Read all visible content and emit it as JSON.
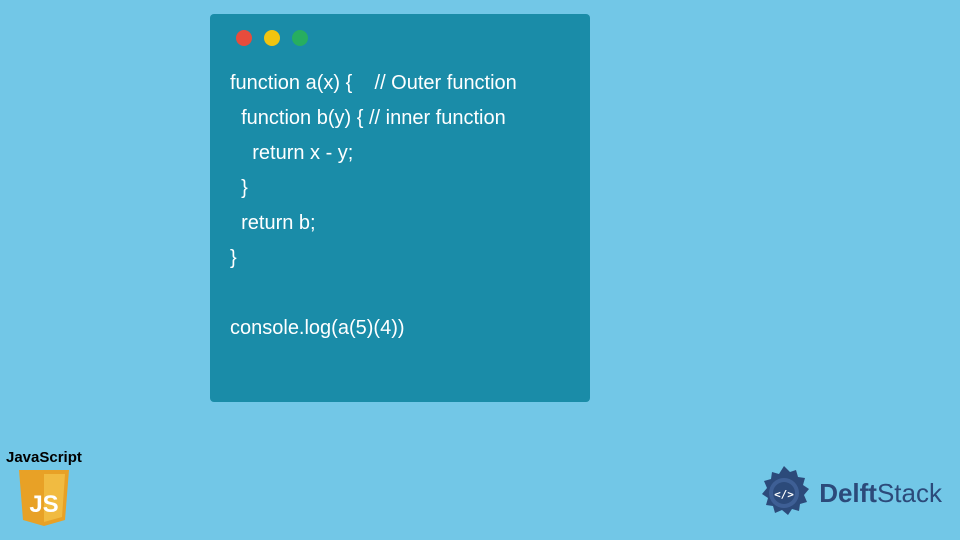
{
  "code": {
    "line1": "function a(x) {    // Outer function",
    "line2": "  function b(y) { // inner function",
    "line3": "    return x - y;",
    "line4": "  }",
    "line5": "  return b;",
    "line6": "}",
    "line7": "",
    "line8": "console.log(a(5)(4))"
  },
  "jsBadge": {
    "label": "JavaScript",
    "shieldText": "JS"
  },
  "delftLogo": {
    "textBold": "Delft",
    "textRegular": "Stack",
    "iconGlyph": "</>"
  },
  "colors": {
    "background": "#72c7e7",
    "codeWindow": "#1a8ca8",
    "dotRed": "#e74c3c",
    "dotYellow": "#f1c40f",
    "dotGreen": "#27ae60"
  }
}
